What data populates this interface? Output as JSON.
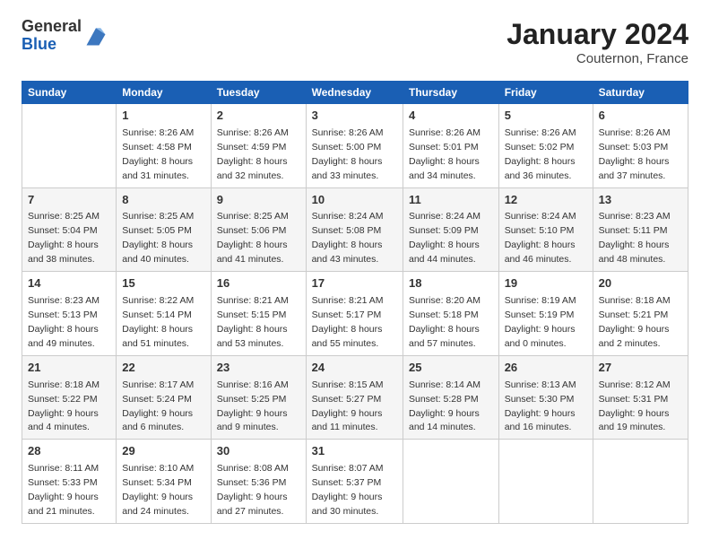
{
  "header": {
    "logo_line1": "General",
    "logo_line2": "Blue",
    "month_title": "January 2024",
    "location": "Couternon, France"
  },
  "weekdays": [
    "Sunday",
    "Monday",
    "Tuesday",
    "Wednesday",
    "Thursday",
    "Friday",
    "Saturday"
  ],
  "weeks": [
    [
      {
        "day": "",
        "info": ""
      },
      {
        "day": "1",
        "info": "Sunrise: 8:26 AM\nSunset: 4:58 PM\nDaylight: 8 hours\nand 31 minutes."
      },
      {
        "day": "2",
        "info": "Sunrise: 8:26 AM\nSunset: 4:59 PM\nDaylight: 8 hours\nand 32 minutes."
      },
      {
        "day": "3",
        "info": "Sunrise: 8:26 AM\nSunset: 5:00 PM\nDaylight: 8 hours\nand 33 minutes."
      },
      {
        "day": "4",
        "info": "Sunrise: 8:26 AM\nSunset: 5:01 PM\nDaylight: 8 hours\nand 34 minutes."
      },
      {
        "day": "5",
        "info": "Sunrise: 8:26 AM\nSunset: 5:02 PM\nDaylight: 8 hours\nand 36 minutes."
      },
      {
        "day": "6",
        "info": "Sunrise: 8:26 AM\nSunset: 5:03 PM\nDaylight: 8 hours\nand 37 minutes."
      }
    ],
    [
      {
        "day": "7",
        "info": "Sunrise: 8:25 AM\nSunset: 5:04 PM\nDaylight: 8 hours\nand 38 minutes."
      },
      {
        "day": "8",
        "info": "Sunrise: 8:25 AM\nSunset: 5:05 PM\nDaylight: 8 hours\nand 40 minutes."
      },
      {
        "day": "9",
        "info": "Sunrise: 8:25 AM\nSunset: 5:06 PM\nDaylight: 8 hours\nand 41 minutes."
      },
      {
        "day": "10",
        "info": "Sunrise: 8:24 AM\nSunset: 5:08 PM\nDaylight: 8 hours\nand 43 minutes."
      },
      {
        "day": "11",
        "info": "Sunrise: 8:24 AM\nSunset: 5:09 PM\nDaylight: 8 hours\nand 44 minutes."
      },
      {
        "day": "12",
        "info": "Sunrise: 8:24 AM\nSunset: 5:10 PM\nDaylight: 8 hours\nand 46 minutes."
      },
      {
        "day": "13",
        "info": "Sunrise: 8:23 AM\nSunset: 5:11 PM\nDaylight: 8 hours\nand 48 minutes."
      }
    ],
    [
      {
        "day": "14",
        "info": "Sunrise: 8:23 AM\nSunset: 5:13 PM\nDaylight: 8 hours\nand 49 minutes."
      },
      {
        "day": "15",
        "info": "Sunrise: 8:22 AM\nSunset: 5:14 PM\nDaylight: 8 hours\nand 51 minutes."
      },
      {
        "day": "16",
        "info": "Sunrise: 8:21 AM\nSunset: 5:15 PM\nDaylight: 8 hours\nand 53 minutes."
      },
      {
        "day": "17",
        "info": "Sunrise: 8:21 AM\nSunset: 5:17 PM\nDaylight: 8 hours\nand 55 minutes."
      },
      {
        "day": "18",
        "info": "Sunrise: 8:20 AM\nSunset: 5:18 PM\nDaylight: 8 hours\nand 57 minutes."
      },
      {
        "day": "19",
        "info": "Sunrise: 8:19 AM\nSunset: 5:19 PM\nDaylight: 9 hours\nand 0 minutes."
      },
      {
        "day": "20",
        "info": "Sunrise: 8:18 AM\nSunset: 5:21 PM\nDaylight: 9 hours\nand 2 minutes."
      }
    ],
    [
      {
        "day": "21",
        "info": "Sunrise: 8:18 AM\nSunset: 5:22 PM\nDaylight: 9 hours\nand 4 minutes."
      },
      {
        "day": "22",
        "info": "Sunrise: 8:17 AM\nSunset: 5:24 PM\nDaylight: 9 hours\nand 6 minutes."
      },
      {
        "day": "23",
        "info": "Sunrise: 8:16 AM\nSunset: 5:25 PM\nDaylight: 9 hours\nand 9 minutes."
      },
      {
        "day": "24",
        "info": "Sunrise: 8:15 AM\nSunset: 5:27 PM\nDaylight: 9 hours\nand 11 minutes."
      },
      {
        "day": "25",
        "info": "Sunrise: 8:14 AM\nSunset: 5:28 PM\nDaylight: 9 hours\nand 14 minutes."
      },
      {
        "day": "26",
        "info": "Sunrise: 8:13 AM\nSunset: 5:30 PM\nDaylight: 9 hours\nand 16 minutes."
      },
      {
        "day": "27",
        "info": "Sunrise: 8:12 AM\nSunset: 5:31 PM\nDaylight: 9 hours\nand 19 minutes."
      }
    ],
    [
      {
        "day": "28",
        "info": "Sunrise: 8:11 AM\nSunset: 5:33 PM\nDaylight: 9 hours\nand 21 minutes."
      },
      {
        "day": "29",
        "info": "Sunrise: 8:10 AM\nSunset: 5:34 PM\nDaylight: 9 hours\nand 24 minutes."
      },
      {
        "day": "30",
        "info": "Sunrise: 8:08 AM\nSunset: 5:36 PM\nDaylight: 9 hours\nand 27 minutes."
      },
      {
        "day": "31",
        "info": "Sunrise: 8:07 AM\nSunset: 5:37 PM\nDaylight: 9 hours\nand 30 minutes."
      },
      {
        "day": "",
        "info": ""
      },
      {
        "day": "",
        "info": ""
      },
      {
        "day": "",
        "info": ""
      }
    ]
  ]
}
